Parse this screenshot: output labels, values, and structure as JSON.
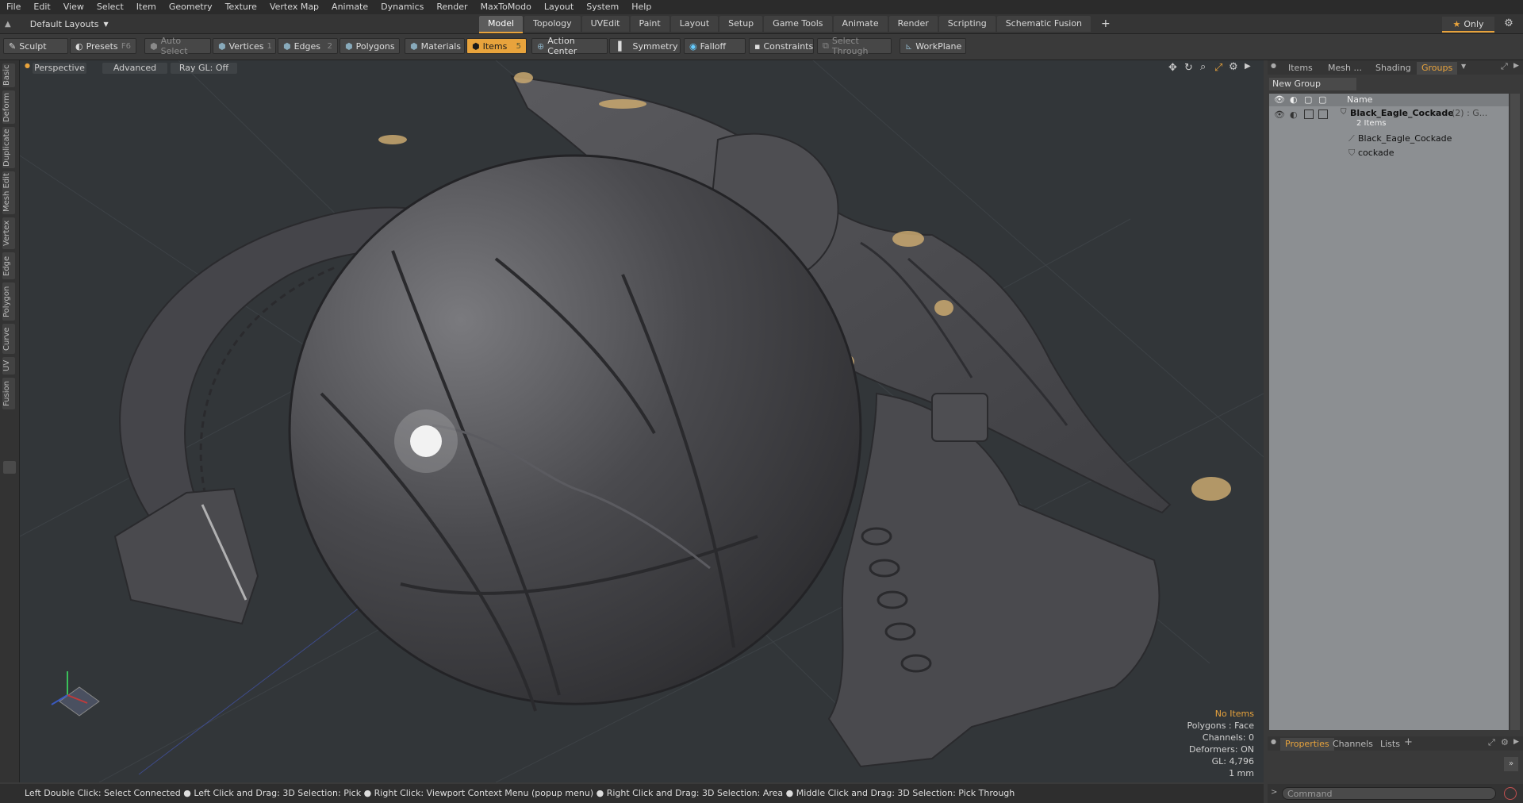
{
  "menu": [
    "File",
    "Edit",
    "View",
    "Select",
    "Item",
    "Geometry",
    "Texture",
    "Vertex Map",
    "Animate",
    "Dynamics",
    "Render",
    "MaxToModo",
    "Layout",
    "System",
    "Help"
  ],
  "layout_select": "Default Layouts",
  "tabs": [
    {
      "label": "Model",
      "active": true
    },
    {
      "label": "Topology"
    },
    {
      "label": "UVEdit"
    },
    {
      "label": "Paint"
    },
    {
      "label": "Layout"
    },
    {
      "label": "Setup"
    },
    {
      "label": "Game Tools"
    },
    {
      "label": "Animate"
    },
    {
      "label": "Render"
    },
    {
      "label": "Scripting"
    },
    {
      "label": "Schematic Fusion"
    }
  ],
  "only_label": "Only",
  "toolbar": {
    "sculpt": "Sculpt",
    "presets": "Presets",
    "presets_key": "F6",
    "auto_select": "Auto Select",
    "vertices": "Vertices",
    "vertices_key": "1",
    "edges": "Edges",
    "edges_key": "2",
    "polygons": "Polygons",
    "materials": "Materials",
    "items": "Items",
    "items_key": "5",
    "action_center": "Action Center",
    "symmetry": "Symmetry",
    "falloff": "Falloff",
    "constraints": "Constraints",
    "select_through": "Select Through",
    "workplane": "WorkPlane"
  },
  "left_tabs": [
    "Basic",
    "Deform",
    "Duplicate",
    "Mesh Edit",
    "Vertex",
    "Edge",
    "Polygon",
    "Curve",
    "UV",
    "Fusion"
  ],
  "viewport": {
    "perspective": "Perspective",
    "advanced": "Advanced",
    "raygl": "Ray GL: Off",
    "info": {
      "no_items": "No Items",
      "polygons": "Polygons : Face",
      "channels": "Channels: 0",
      "deformers": "Deformers: ON",
      "gl": "GL: 4,796",
      "unit": "1 mm"
    }
  },
  "right_panel": {
    "tabs": [
      "Items",
      "Mesh ...",
      "Shading",
      "Groups"
    ],
    "active_tab": "Groups",
    "new_group": "New Group",
    "col_name": "Name",
    "group_name": "Black_Eagle_Cockade",
    "group_count": "(2) : G...",
    "group_items": "2 Items",
    "children": [
      "Black_Eagle_Cockade",
      "cockade"
    ],
    "bottom_tabs": [
      "Properties",
      "Channels",
      "Lists"
    ],
    "bottom_active": "Properties"
  },
  "status_bar": "Left Double Click: Select Connected ● Left Click and Drag: 3D Selection: Pick ● Right Click: Viewport Context Menu (popup menu) ● Right Click and Drag: 3D Selection: Area ● Middle Click and Drag: 3D Selection: Pick Through",
  "command_placeholder": "Command",
  "colors": {
    "accent": "#e8a33c",
    "viewport_bg": "#323639",
    "model": "#4a4a4d"
  }
}
